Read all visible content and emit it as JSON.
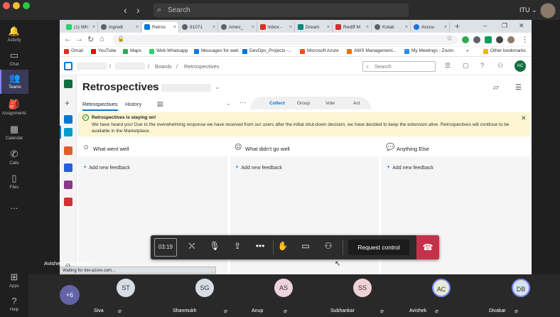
{
  "window": {
    "search_placeholder": "Search",
    "org": "ITU"
  },
  "teams_rail": [
    {
      "label": "Activity",
      "icon": "bell-icon"
    },
    {
      "label": "Chat",
      "icon": "chat-icon"
    },
    {
      "label": "Teams",
      "icon": "teams-icon",
      "active": true
    },
    {
      "label": "Assignments",
      "icon": "assignments-icon"
    },
    {
      "label": "Calendar",
      "icon": "calendar-icon"
    },
    {
      "label": "Calls",
      "icon": "phone-icon"
    },
    {
      "label": "Files",
      "icon": "files-icon"
    },
    {
      "label": "...",
      "icon": "more-icon"
    },
    {
      "label": "Apps",
      "icon": "apps-icon"
    },
    {
      "label": "Help",
      "icon": "help-icon"
    }
  ],
  "browser": {
    "tabs": [
      {
        "label": "(1) Wh:",
        "color": "#25d366"
      },
      {
        "label": "Ingredi",
        "color": "#5f6368"
      },
      {
        "label": "Retros",
        "color": "#0078d4",
        "active": true
      },
      {
        "label": "91071",
        "color": "#5f6368"
      },
      {
        "label": "Ames_",
        "color": "#5f6368"
      },
      {
        "label": "Inbox -",
        "color": "#d93025"
      },
      {
        "label": "Dream",
        "color": "#00897b"
      },
      {
        "label": "Rediff M",
        "color": "#d32f2f"
      },
      {
        "label": "Kotak",
        "color": "#5f6368"
      },
      {
        "label": "Accou",
        "color": "#1a73e8"
      }
    ],
    "bookmarks": [
      {
        "label": "Gmail",
        "color": "#d93025"
      },
      {
        "label": "YouTube",
        "color": "#ff0000"
      },
      {
        "label": "Maps",
        "color": "#34a853"
      },
      {
        "label": "Web Whatsapp",
        "color": "#25d366"
      },
      {
        "label": "Messages for web",
        "color": "#1a73e8"
      },
      {
        "label": "DevOps_Projects -...",
        "color": "#0078d4"
      },
      {
        "label": "Microsoft Azure",
        "color": "#f25022"
      },
      {
        "label": "AWS Management...",
        "color": "#e8710a"
      },
      {
        "label": "My Meetings - Zoom",
        "color": "#2d8cff"
      },
      {
        "label": "»",
        "color": ""
      },
      {
        "label": "Other bookmarks",
        "color": "#f5b400"
      }
    ],
    "status_text": "Waiting for dev.azure.com..."
  },
  "ado": {
    "breadcrumbs": [
      "Boards",
      "Retrospectives"
    ],
    "search_placeholder": "Search",
    "user_initials": "AC",
    "title": "Retrospectives",
    "subtabs": [
      "Retrospectives",
      "History"
    ],
    "phases": [
      "Collect",
      "Group",
      "Vote",
      "Act"
    ],
    "active_phase": "Collect",
    "banner": {
      "title": "Retrospectives is staying on!",
      "body": "We have heard you! Due to the overwhelming response we have received from our users after the initial shut-down decision, we have decided to keep the extension alive. Retrospectives will continue to be available in the Marketplace."
    },
    "columns": [
      {
        "title": "What went well",
        "icon": "smile-icon"
      },
      {
        "title": "What didn't go well",
        "icon": "frown-icon"
      },
      {
        "title": "Anything Else",
        "icon": "comments-icon"
      }
    ],
    "add_feedback": "Add new feedback"
  },
  "meeting": {
    "timer": "03:19",
    "request_control": "Request control",
    "presenter": "Avishek Chakraborty",
    "more_count": "+6",
    "participants": [
      {
        "initials": "ST",
        "name": "Siva",
        "color": "#d6dde6"
      },
      {
        "initials": "SG",
        "name": "Shanmukh",
        "color": "#d6dde6"
      },
      {
        "initials": "AS",
        "name": "Anup",
        "color": "#ebd2dc"
      },
      {
        "initials": "SS",
        "name": "Subhankar",
        "color": "#f0d2d6"
      },
      {
        "initials": "AC",
        "name": "Avishek",
        "color": "#e6ecd6"
      },
      {
        "initials": "DB",
        "name": "Divakar",
        "color": "#d6e4f0"
      }
    ]
  }
}
